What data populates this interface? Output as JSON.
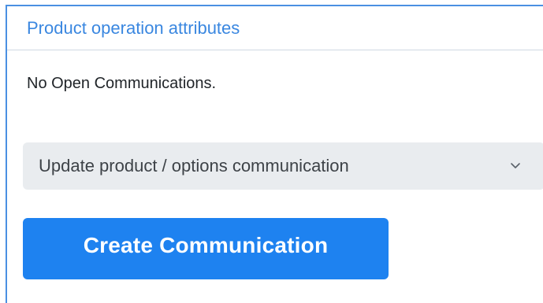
{
  "panel": {
    "title": "Product operation attributes",
    "empty_message": "No Open Communications."
  },
  "communication_type_select": {
    "selected": "Update product / options communication",
    "icon": "chevron-down-icon"
  },
  "create_button": {
    "label": "Create Communication"
  },
  "colors": {
    "accent": "#1e82f0",
    "title": "#3a87e0",
    "panel_border": "#4a90e2",
    "select_background": "#e9ecef"
  }
}
